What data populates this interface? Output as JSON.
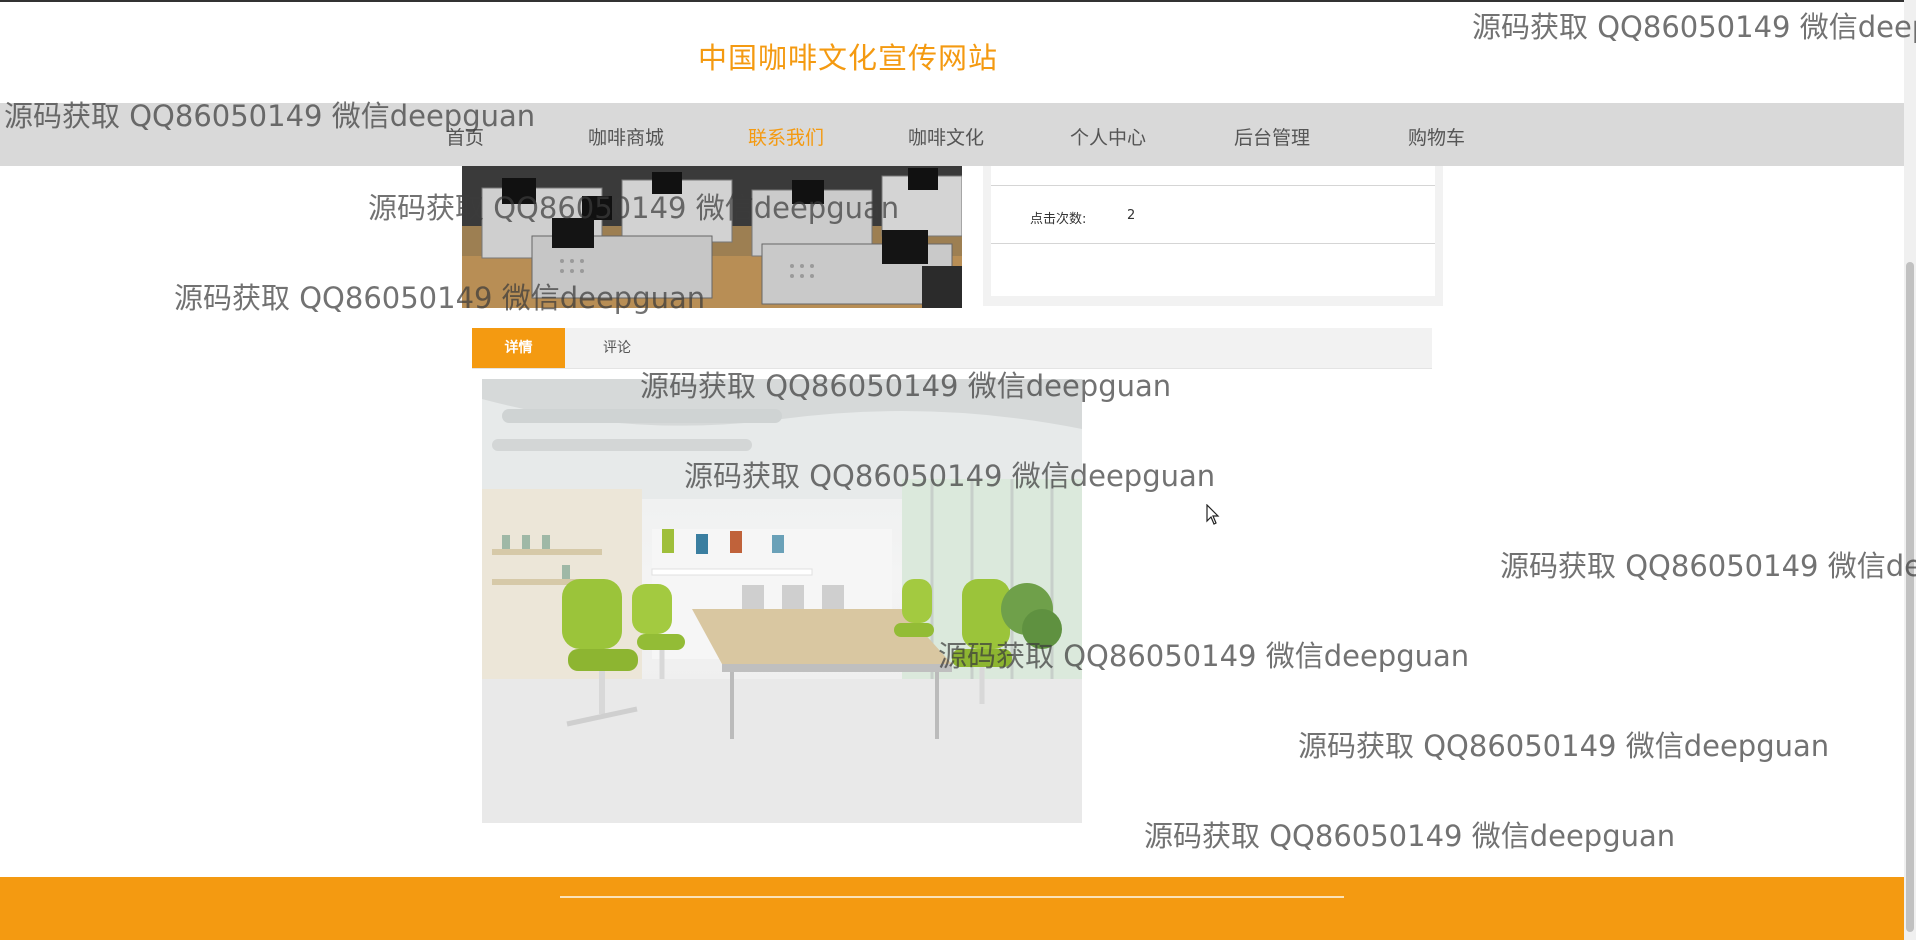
{
  "site": {
    "title": "中国咖啡文化宣传网站"
  },
  "nav": {
    "items": [
      {
        "label": "首页",
        "active": false
      },
      {
        "label": "咖啡商城",
        "active": false
      },
      {
        "label": "联系我们",
        "active": true
      },
      {
        "label": "咖啡文化",
        "active": false
      },
      {
        "label": "个人中心",
        "active": false
      },
      {
        "label": "后台管理",
        "active": false
      },
      {
        "label": "购物车",
        "active": false
      }
    ]
  },
  "info": {
    "click_label": "点击次数:",
    "click_value": "2"
  },
  "tabs": {
    "details": "详情",
    "comments": "评论"
  },
  "watermark": {
    "text": "源码获取 QQ86050149 微信deepguan"
  },
  "colors": {
    "accent": "#f49a11",
    "nav_bg": "#d9d9d9",
    "footer_bg": "#f49a11"
  },
  "icons": {
    "cursor": "mouse-cursor-icon"
  }
}
